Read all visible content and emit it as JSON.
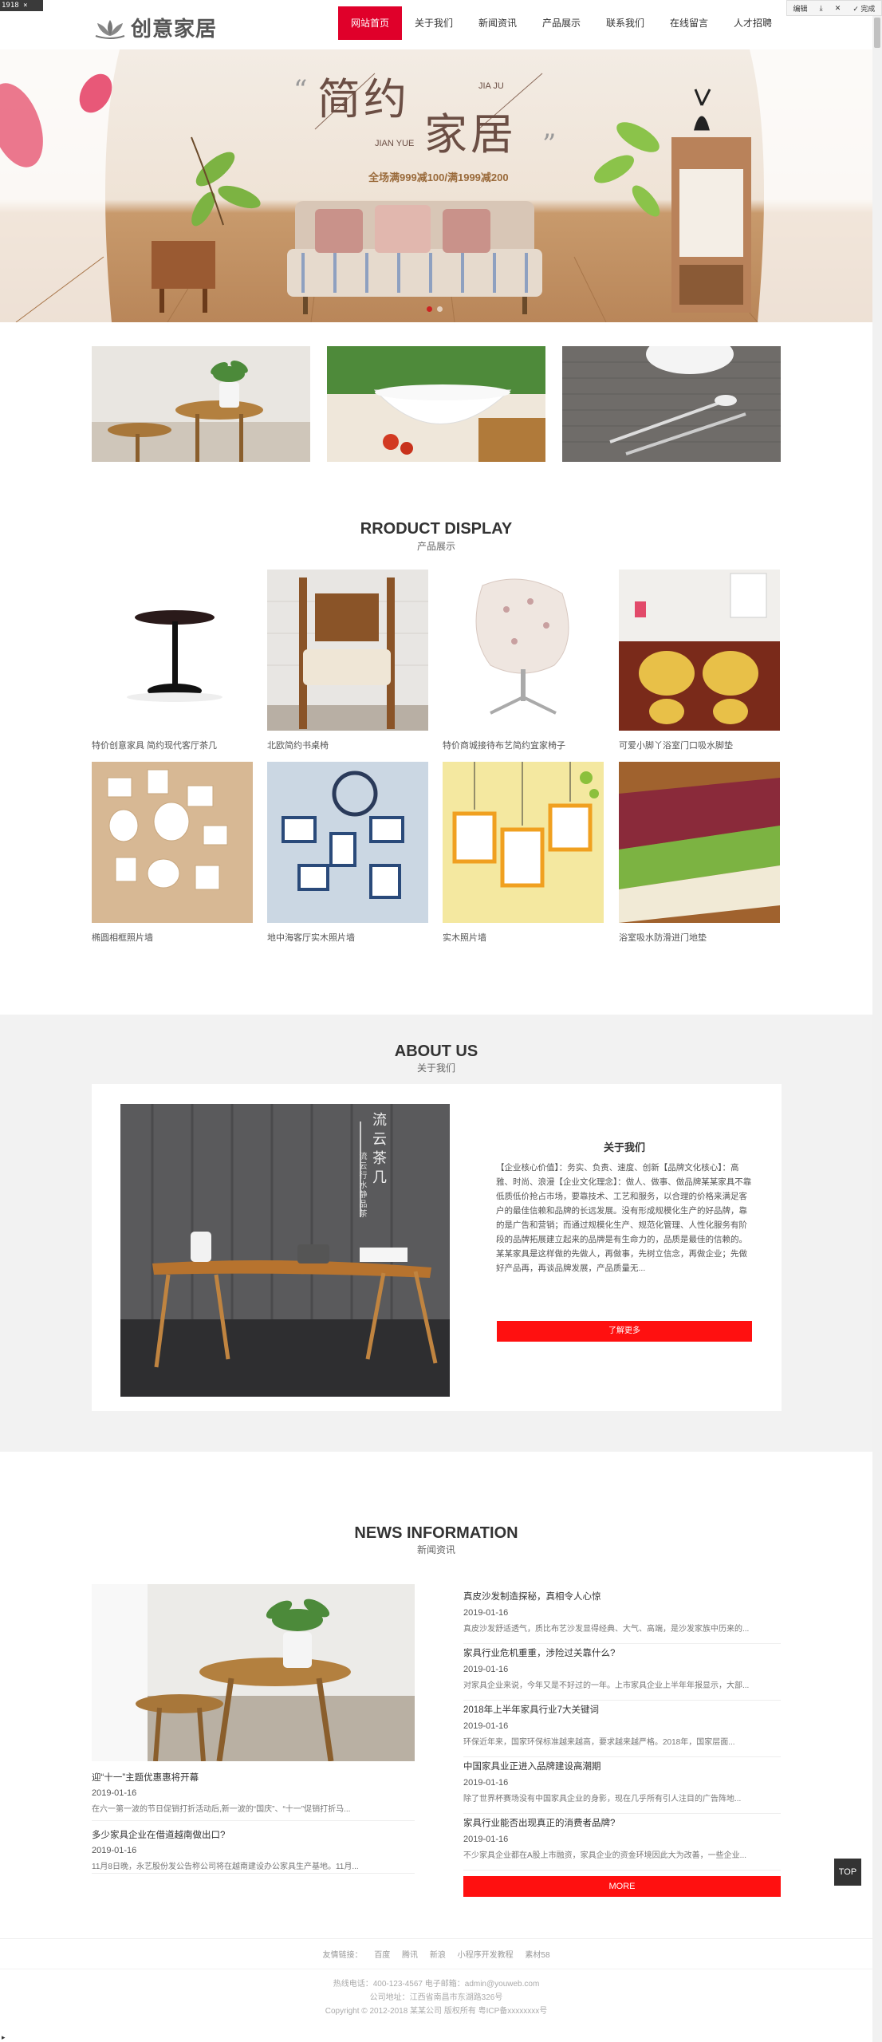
{
  "capture": {
    "dimensions": "1918 × 4359",
    "toolbar": [
      "编辑",
      "完成"
    ]
  },
  "header": {
    "logo_text": "创意家居",
    "nav": [
      "网站首页",
      "关于我们",
      "新闻资讯",
      "产品展示",
      "联系我们",
      "在线留言",
      "人才招聘"
    ],
    "active_index": 0
  },
  "banner": {
    "headline_a": "简约",
    "headline_b": "家居",
    "pinyin_a": "JIA JU",
    "pinyin_b": "JIAN YUE",
    "promo": "全场满999减100/满1999减200",
    "slides": 2,
    "current_slide": 1
  },
  "products": {
    "title": "RRODUCT DISPLAY",
    "subtitle": "产品展示",
    "items": [
      "特价创意家具 简约现代客厅茶几",
      "北欧简约书桌椅",
      "特价商城接待布艺简约宜家椅子",
      "可爱小脚丫浴室门口吸水脚垫",
      "椭圆相框照片墙",
      "地中海客厅实木照片墙",
      "实木照片墙",
      "浴室吸水防滑进门地垫"
    ]
  },
  "about": {
    "title": "ABOUT US",
    "subtitle": "关于我们",
    "box_title": "关于我们",
    "image_text": "流云茶几",
    "image_text2": "流云行水静品茶",
    "text": "【企业核心价值】：务实、负责、速度、创新【品牌文化核心】：高雅、时尚、浪漫【企业文化理念】：做人、做事、做品牌某某家具不靠低质低价抢占市场，要靠技术、工艺和服务，以合理的价格来满足客户的最佳信赖和品牌的长远发展。没有形成规模化生产的好品牌，靠的是广告和营销；而通过规模化生产、规范化管理、人性化服务有阶段的品牌拓展建立起来的品牌是有生命力的，品质是最佳的信赖的。某某家具是这样做的先做人，再做事，先树立信念，再做企业；先做好产品再，再谈品牌发展，产品质量无...",
    "button": "了解更多"
  },
  "news": {
    "title": "NEWS INFORMATION",
    "subtitle": "新闻资讯",
    "left": [
      {
        "title": "迎“十一”主题优惠惠将开幕",
        "date": "2019-01-16",
        "summary": "在六一第一波的节日促销打折活动后,新一波的“国庆”、“十一”促销打折马..."
      },
      {
        "title": "多少家具企业在借道越南做出口?",
        "date": "2019-01-16",
        "summary": "11月8日晚，永艺股份发公告称公司将在越南建设办公家具生产基地。11月..."
      }
    ],
    "right": [
      {
        "title": "真皮沙发制造探秘，真相令人心惊",
        "date": "2019-01-16",
        "summary": "真皮沙发舒适透气，质比布艺沙发显得经典、大气、高端，是沙发家族中历来的..."
      },
      {
        "title": "家具行业危机重重，涉险过关靠什么?",
        "date": "2019-01-16",
        "summary": "对家具企业来说，今年又是不好过的一年。上市家具企业上半年年报显示，大部..."
      },
      {
        "title": "2018年上半年家具行业7大关键词",
        "date": "2019-01-16",
        "summary": "环保近年来，国家环保标准越来越高，要求越来越严格。2018年，国家层面..."
      },
      {
        "title": "中国家具业正进入品牌建设高潮期",
        "date": "2019-01-16",
        "summary": "除了世界杯赛场没有中国家具企业的身影，现在几乎所有引人注目的广告阵地..."
      },
      {
        "title": "家具行业能否出现真正的消费者品牌?",
        "date": "2019-01-16",
        "summary": "不少家具企业都在A股上市融资，家具企业的资金环境因此大为改善，一些企业..."
      }
    ],
    "more": "MORE"
  },
  "top_button": "TOP",
  "footer": {
    "links_label": "友情链接：",
    "links": [
      "百度",
      "腾讯",
      "新浪",
      "小程序开发教程",
      "素材58"
    ],
    "line1": "热线电话：400-123-4567    电子邮箱：admin@youweb.com",
    "line2": "公司地址：江西省南昌市东湖路326号",
    "line3": "Copyright © 2012-2018 某某公司 版权所有  粤ICP备xxxxxxxx号"
  }
}
